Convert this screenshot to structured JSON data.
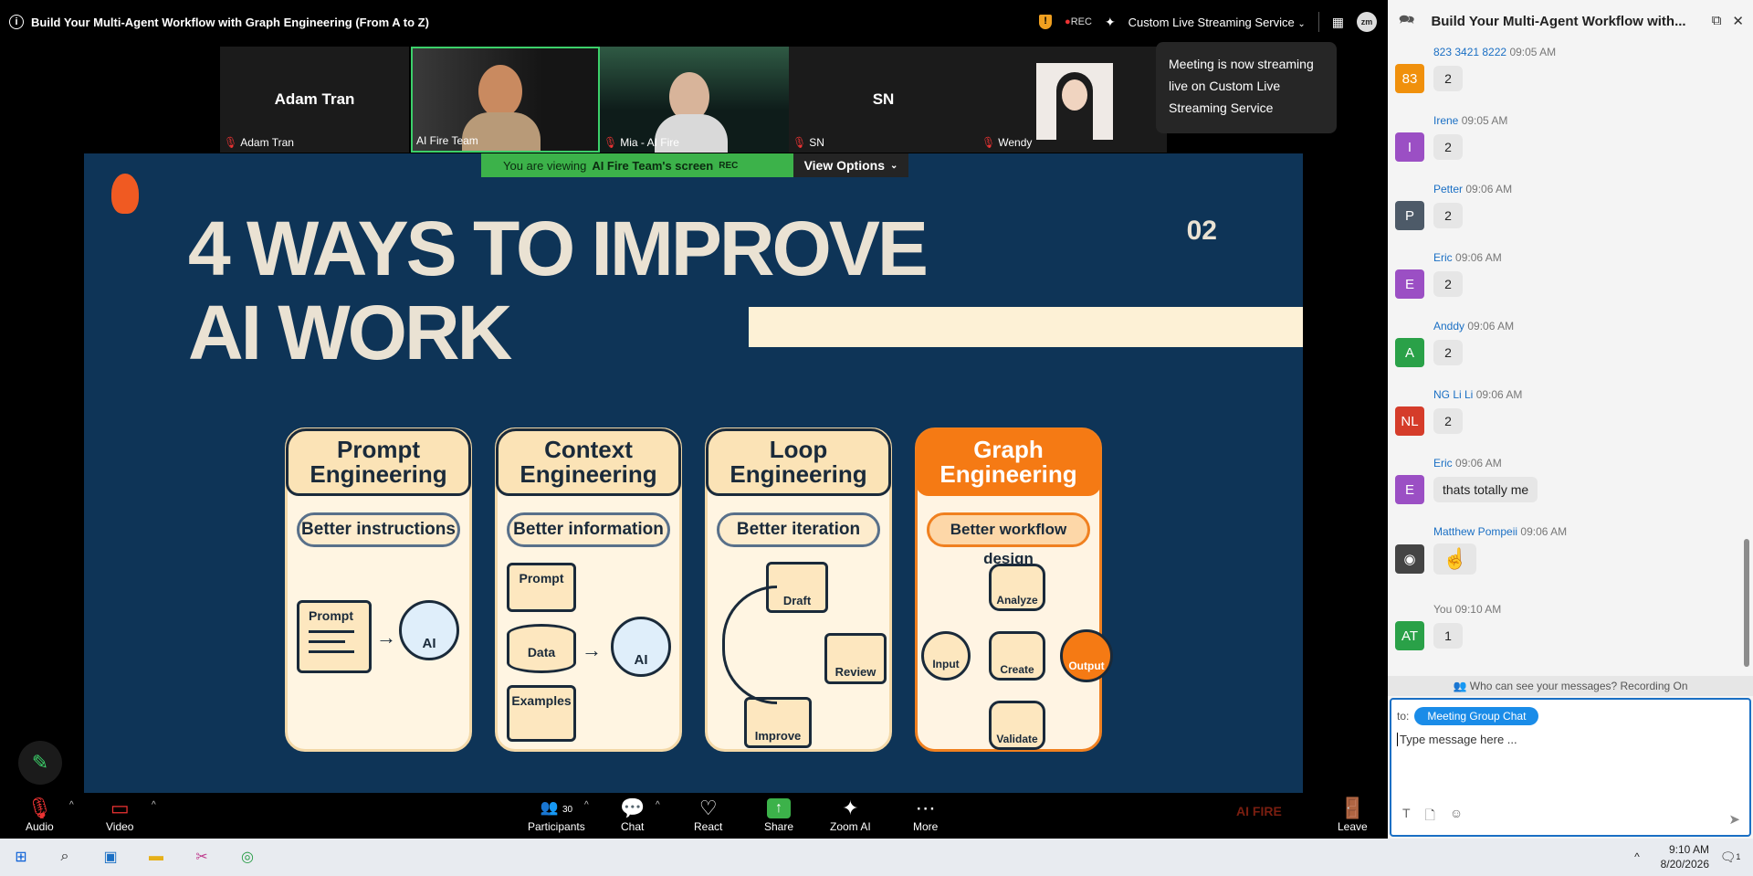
{
  "title_bar": {
    "title": "Build Your Multi-Agent Workflow with Graph Engineering (From A to Z)",
    "rec": "REC",
    "streaming_menu": "Custom Live Streaming Service",
    "avatar_initials": "zm"
  },
  "participants": [
    {
      "display": "Adam Tran",
      "name": "Adam Tran",
      "video": false
    },
    {
      "display": "",
      "name": "AI Fire Team",
      "video": true
    },
    {
      "display": "",
      "name": "Mia - AI Fire",
      "video": true
    },
    {
      "display": "SN",
      "name": "SN",
      "video": false
    },
    {
      "display": "",
      "name": "Wendy",
      "video": true
    }
  ],
  "toast": {
    "text": "Meeting is now streaming live on Custom Live Streaming Service"
  },
  "share_bar": {
    "viewing_prefix": "You are viewing",
    "viewing_name": "AI Fire Team's screen",
    "rec": "REC",
    "view_options": "View Options"
  },
  "slide": {
    "title_line1": "4 WAYS TO IMPROVE",
    "title_line2": "AI WORK",
    "number": "02",
    "cards": [
      {
        "title_line1": "Prompt",
        "title_line2": "Engineering",
        "subtitle": "Better instructions",
        "items": [
          "Prompt",
          "AI"
        ]
      },
      {
        "title_line1": "Context",
        "title_line2": "Engineering",
        "subtitle": "Better information",
        "items": [
          "Prompt",
          "Data",
          "Examples",
          "AI"
        ]
      },
      {
        "title_line1": "Loop",
        "title_line2": "Engineering",
        "subtitle": "Better iteration",
        "items": [
          "Draft",
          "Review",
          "Improve"
        ]
      },
      {
        "title_line1": "Graph",
        "title_line2": "Engineering",
        "subtitle": "Better workflow design",
        "items": [
          "Input",
          "Analyze",
          "Create",
          "Validate",
          "Output"
        ]
      }
    ]
  },
  "toolbar": {
    "audio": "Audio",
    "video": "Video",
    "participants": "Participants",
    "participants_count": "30",
    "chat": "Chat",
    "react": "React",
    "share": "Share",
    "zoom_ai": "Zoom AI",
    "more": "More",
    "watermark": "AI FIRE",
    "leave": "Leave"
  },
  "chat": {
    "title": "Build Your Multi-Agent Workflow with...",
    "messages": [
      {
        "name": "823 3421 8222",
        "time": "09:05 AM",
        "initials": "83",
        "color": "#f0900c",
        "text": "2"
      },
      {
        "name": "Irene",
        "time": "09:05 AM",
        "initials": "I",
        "color": "#9b4fc4",
        "text": "2"
      },
      {
        "name": "Petter",
        "time": "09:06 AM",
        "initials": "P",
        "color": "#4d5a68",
        "text": "2"
      },
      {
        "name": "Eric",
        "time": "09:06 AM",
        "initials": "E",
        "color": "#9b4fc4",
        "text": "2"
      },
      {
        "name": "Anddy",
        "time": "09:06 AM",
        "initials": "A",
        "color": "#2aa148",
        "text": "2"
      },
      {
        "name": "NG Li Li",
        "time": "09:06 AM",
        "initials": "NL",
        "color": "#d53c2a",
        "text": "2"
      },
      {
        "name": "Eric",
        "time": "09:06 AM",
        "initials": "E",
        "color": "#9b4fc4",
        "text": "thats totally me"
      },
      {
        "name": "Matthew Pompeii",
        "time": "09:06 AM",
        "initials": "",
        "color": "#444444",
        "text": "☝"
      },
      {
        "name": "You",
        "time": "09:10 AM",
        "initials": "AT",
        "color": "#2aa148",
        "text": "1"
      }
    ],
    "who_can_see": "Who can see your messages? Recording On",
    "to_label": "to:",
    "to_chip": "Meeting Group Chat",
    "placeholder": "Type message here ..."
  },
  "taskbar": {
    "time": "9:10 AM",
    "date": "8/20/2026",
    "notification_count": "1"
  }
}
